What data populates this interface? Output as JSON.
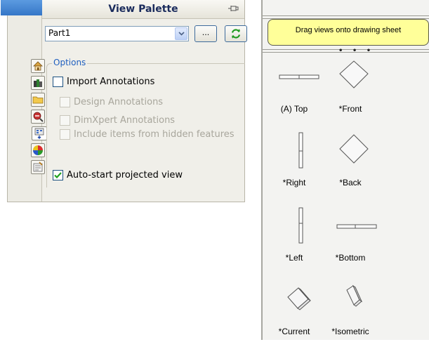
{
  "palette": {
    "title": "View Palette",
    "part_select": {
      "value": "Part1"
    },
    "browse_label": "...",
    "options": {
      "legend": "Options",
      "import_annotations": {
        "label": "Import Annotations",
        "checked": false
      },
      "design_annotations": {
        "label": "Design Annotations",
        "checked": false
      },
      "dimxpert_annotations": {
        "label": "DimXpert Annotations",
        "checked": false
      },
      "hidden_features": {
        "label": "Include items from hidden features",
        "checked": false
      },
      "auto_start": {
        "label": "Auto-start projected view",
        "checked": true
      }
    }
  },
  "views_panel": {
    "banner": "Drag views onto drawing sheet",
    "views": [
      {
        "label": "(A) Top",
        "icon": "top-view-icon"
      },
      {
        "label": "*Front",
        "icon": "front-view-icon"
      },
      {
        "label": "*Right",
        "icon": "right-view-icon"
      },
      {
        "label": "*Back",
        "icon": "back-view-icon"
      },
      {
        "label": "*Left",
        "icon": "left-view-icon"
      },
      {
        "label": "*Bottom",
        "icon": "bottom-view-icon"
      },
      {
        "label": "*Current",
        "icon": "current-view-icon"
      },
      {
        "label": "*Isometric",
        "icon": "isometric-view-icon"
      }
    ]
  },
  "colors": {
    "banner_bg": "#ffff99",
    "options_legend": "#1f5fbf",
    "header_text": "#1a2b5c",
    "check_green": "#21a121"
  }
}
